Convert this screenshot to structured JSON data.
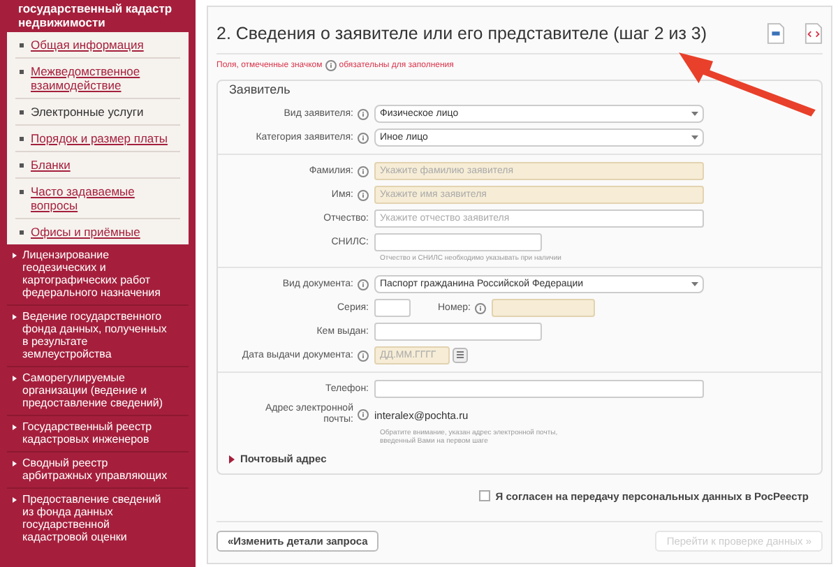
{
  "sidebar": {
    "header": "государственный кадастр недвижимости",
    "submenu": [
      {
        "label": "Общая информация",
        "selected": false
      },
      {
        "label": "Межведомственное взаимодействие",
        "selected": false
      },
      {
        "label": "Электронные услуги",
        "selected": true
      },
      {
        "label": "Порядок и размер платы",
        "selected": false
      },
      {
        "label": "Бланки",
        "selected": false
      },
      {
        "label": "Часто задаваемые вопросы",
        "selected": false
      },
      {
        "label": "Офисы и приёмные",
        "selected": false
      }
    ],
    "sections": [
      "Лицензирование геодезических и картографических работ федерального назначения",
      "Ведение государственного фонда данных, полученных в результате землеустройства",
      "Саморегулируемые организации (ведение и предоставление сведений)",
      "Государственный реестр кадастровых инженеров",
      "Сводный реестр арбитражных управляющих",
      "Предоставление сведений из фонда данных государственной кадастровой оценки"
    ]
  },
  "form": {
    "title": "2. Сведения о заявителе или его представителе (шаг 2 из 3)",
    "note_before": "Поля, отмеченные значком",
    "note_after": "обязательны для заполнения",
    "legend": "Заявитель",
    "fields": [
      {
        "kind": "select",
        "label": "Вид заявителя:",
        "info": true,
        "value": "Физическое лицо"
      },
      {
        "kind": "select",
        "label": "Категория заявителя:",
        "info": true,
        "value": "Иное лицо"
      },
      {
        "kind": "divider"
      },
      {
        "kind": "input",
        "label": "Фамилия:",
        "info": true,
        "placeholder": "Укажите фамилию заявителя",
        "required": true
      },
      {
        "kind": "input",
        "label": "Имя:",
        "info": true,
        "placeholder": "Укажите имя заявителя",
        "required": true
      },
      {
        "kind": "input",
        "label": "Отчество:",
        "info": false,
        "placeholder": "Укажите отчество заявителя",
        "required": false
      },
      {
        "kind": "input-medium",
        "label": "СНИЛС:",
        "info": false,
        "required": false
      },
      {
        "kind": "hint",
        "text": "Отчество и СНИЛС необходимо указывать при наличии"
      },
      {
        "kind": "divider"
      },
      {
        "kind": "select",
        "label": "Вид документа:",
        "info": true,
        "value": "Паспорт гражданина Российской Федерации"
      },
      {
        "kind": "pair",
        "label": "Серия:",
        "info": false,
        "required": false,
        "label2": "Номер:",
        "info2": true,
        "required2": true
      },
      {
        "kind": "input-medium",
        "label": "Кем выдан:",
        "info": false,
        "required": false
      },
      {
        "kind": "date",
        "label": "Дата выдачи документа:",
        "info": true,
        "placeholder": "ДД.ММ.ГГГГ",
        "required": true
      },
      {
        "kind": "divider"
      },
      {
        "kind": "input",
        "label": "Телефон:",
        "info": false,
        "required": false
      },
      {
        "kind": "static",
        "label": "Адрес электронной почты:",
        "info": true,
        "value": "interalex@pochta.ru"
      },
      {
        "kind": "hint",
        "text": "Обратите внимание, указан адрес электронной почты, введенный Вами на первом шаге"
      }
    ],
    "postal": {
      "label": "Почтовый адрес",
      "expanded": false
    },
    "consent": {
      "label": "Я согласен на передачу персональных данных в РосРеестр",
      "checked": false
    },
    "buttons": [
      {
        "label": "«Изменить детали запроса",
        "disabled": false
      },
      {
        "label": "Перейти к проверке данных »",
        "disabled": true
      }
    ]
  }
}
